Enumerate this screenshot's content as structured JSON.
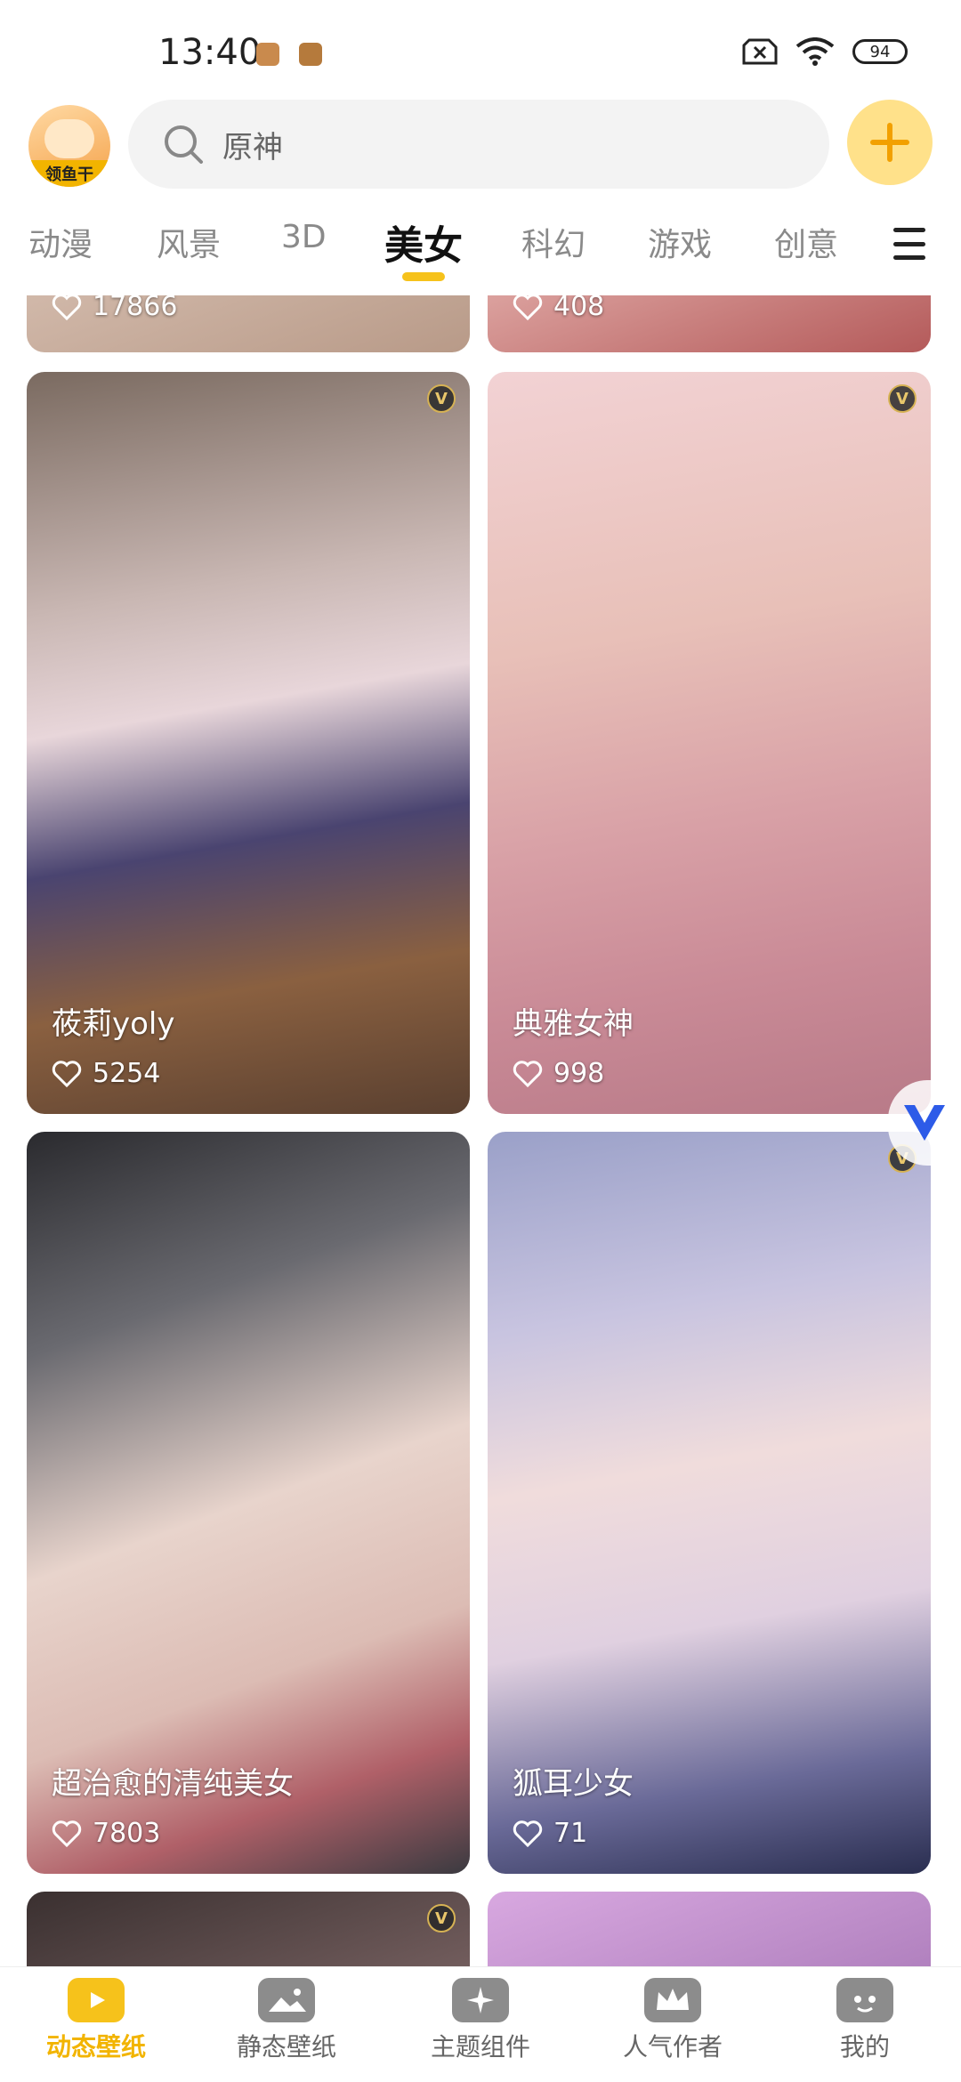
{
  "status_bar": {
    "time": "13:40",
    "battery": "94"
  },
  "header": {
    "avatar_label": "领鱼干",
    "search_placeholder": "原神"
  },
  "tabs": [
    {
      "label": "动漫"
    },
    {
      "label": "风景"
    },
    {
      "label": "3D"
    },
    {
      "label": "美女"
    },
    {
      "label": "科幻"
    },
    {
      "label": "游戏"
    },
    {
      "label": "创意"
    }
  ],
  "active_tab": "美女",
  "cards": [
    {
      "title": "",
      "likes": "17866"
    },
    {
      "title": "",
      "likes": "408"
    },
    {
      "title": "莜莉yoly",
      "likes": "5254"
    },
    {
      "title": "典雅女神",
      "likes": "998"
    },
    {
      "title": "超治愈的清纯美女",
      "likes": "7803"
    },
    {
      "title": "狐耳少女",
      "likes": "71"
    }
  ],
  "bottom_nav": [
    {
      "label": "动态壁纸"
    },
    {
      "label": "静态壁纸"
    },
    {
      "label": "主题组件"
    },
    {
      "label": "人气作者"
    },
    {
      "label": "我的"
    }
  ],
  "colors": {
    "accent": "#f6c21b",
    "nav_active": "#f2b400",
    "vip_gold": "#d6b254"
  },
  "icons": [
    "search-icon",
    "plus-icon",
    "menu-icon",
    "heart-icon",
    "vip-badge-icon",
    "wifi-icon",
    "battery-icon"
  ]
}
